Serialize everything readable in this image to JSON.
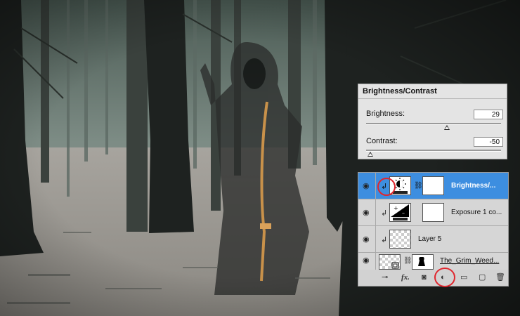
{
  "photo": {
    "description_icon": "grim-reaper-forest-photo-icon",
    "colors": {
      "fog": "#7c8a83",
      "ground": "#a9a59f",
      "trees": "#1f2320"
    }
  },
  "brightness_contrast": {
    "title": "Brightness/Contrast",
    "brightness_label": "Brightness:",
    "brightness_value": "29",
    "brightness_level": 0.6,
    "contrast_label": "Contrast:",
    "contrast_value": "-50",
    "contrast_level": 0.0
  },
  "layers": {
    "rows": [
      {
        "name": "Brightness/...",
        "selected": true,
        "thumb_icon": "brightness-contrast-adjustment-icon",
        "clipped": true
      },
      {
        "name": "Exposure 1 co...",
        "selected": false,
        "thumb_icon": "exposure-adjustment-icon",
        "clipped": true
      },
      {
        "name": "Layer 5",
        "selected": false,
        "thumb_icon": "transparent-layer-icon",
        "clipped": true
      },
      {
        "name": "The_Grim_Weed...",
        "selected": false,
        "thumb_icon": "smart-object-layer-icon",
        "clipped": false
      }
    ],
    "toolbar": [
      "link-layers-icon",
      "fx-icon",
      "add-mask-icon",
      "new-adjustment-layer-icon",
      "new-group-icon",
      "new-layer-icon",
      "delete-layer-icon"
    ],
    "toolbar_glyphs": {
      "link": "⊸",
      "fx": "fx.",
      "mask": "◙",
      "adjust": "◐",
      "group": "▭",
      "new": "▢",
      "delete": "🗑"
    }
  },
  "highlight_color": "#e0262e",
  "selection_color": "#3d8ee0"
}
